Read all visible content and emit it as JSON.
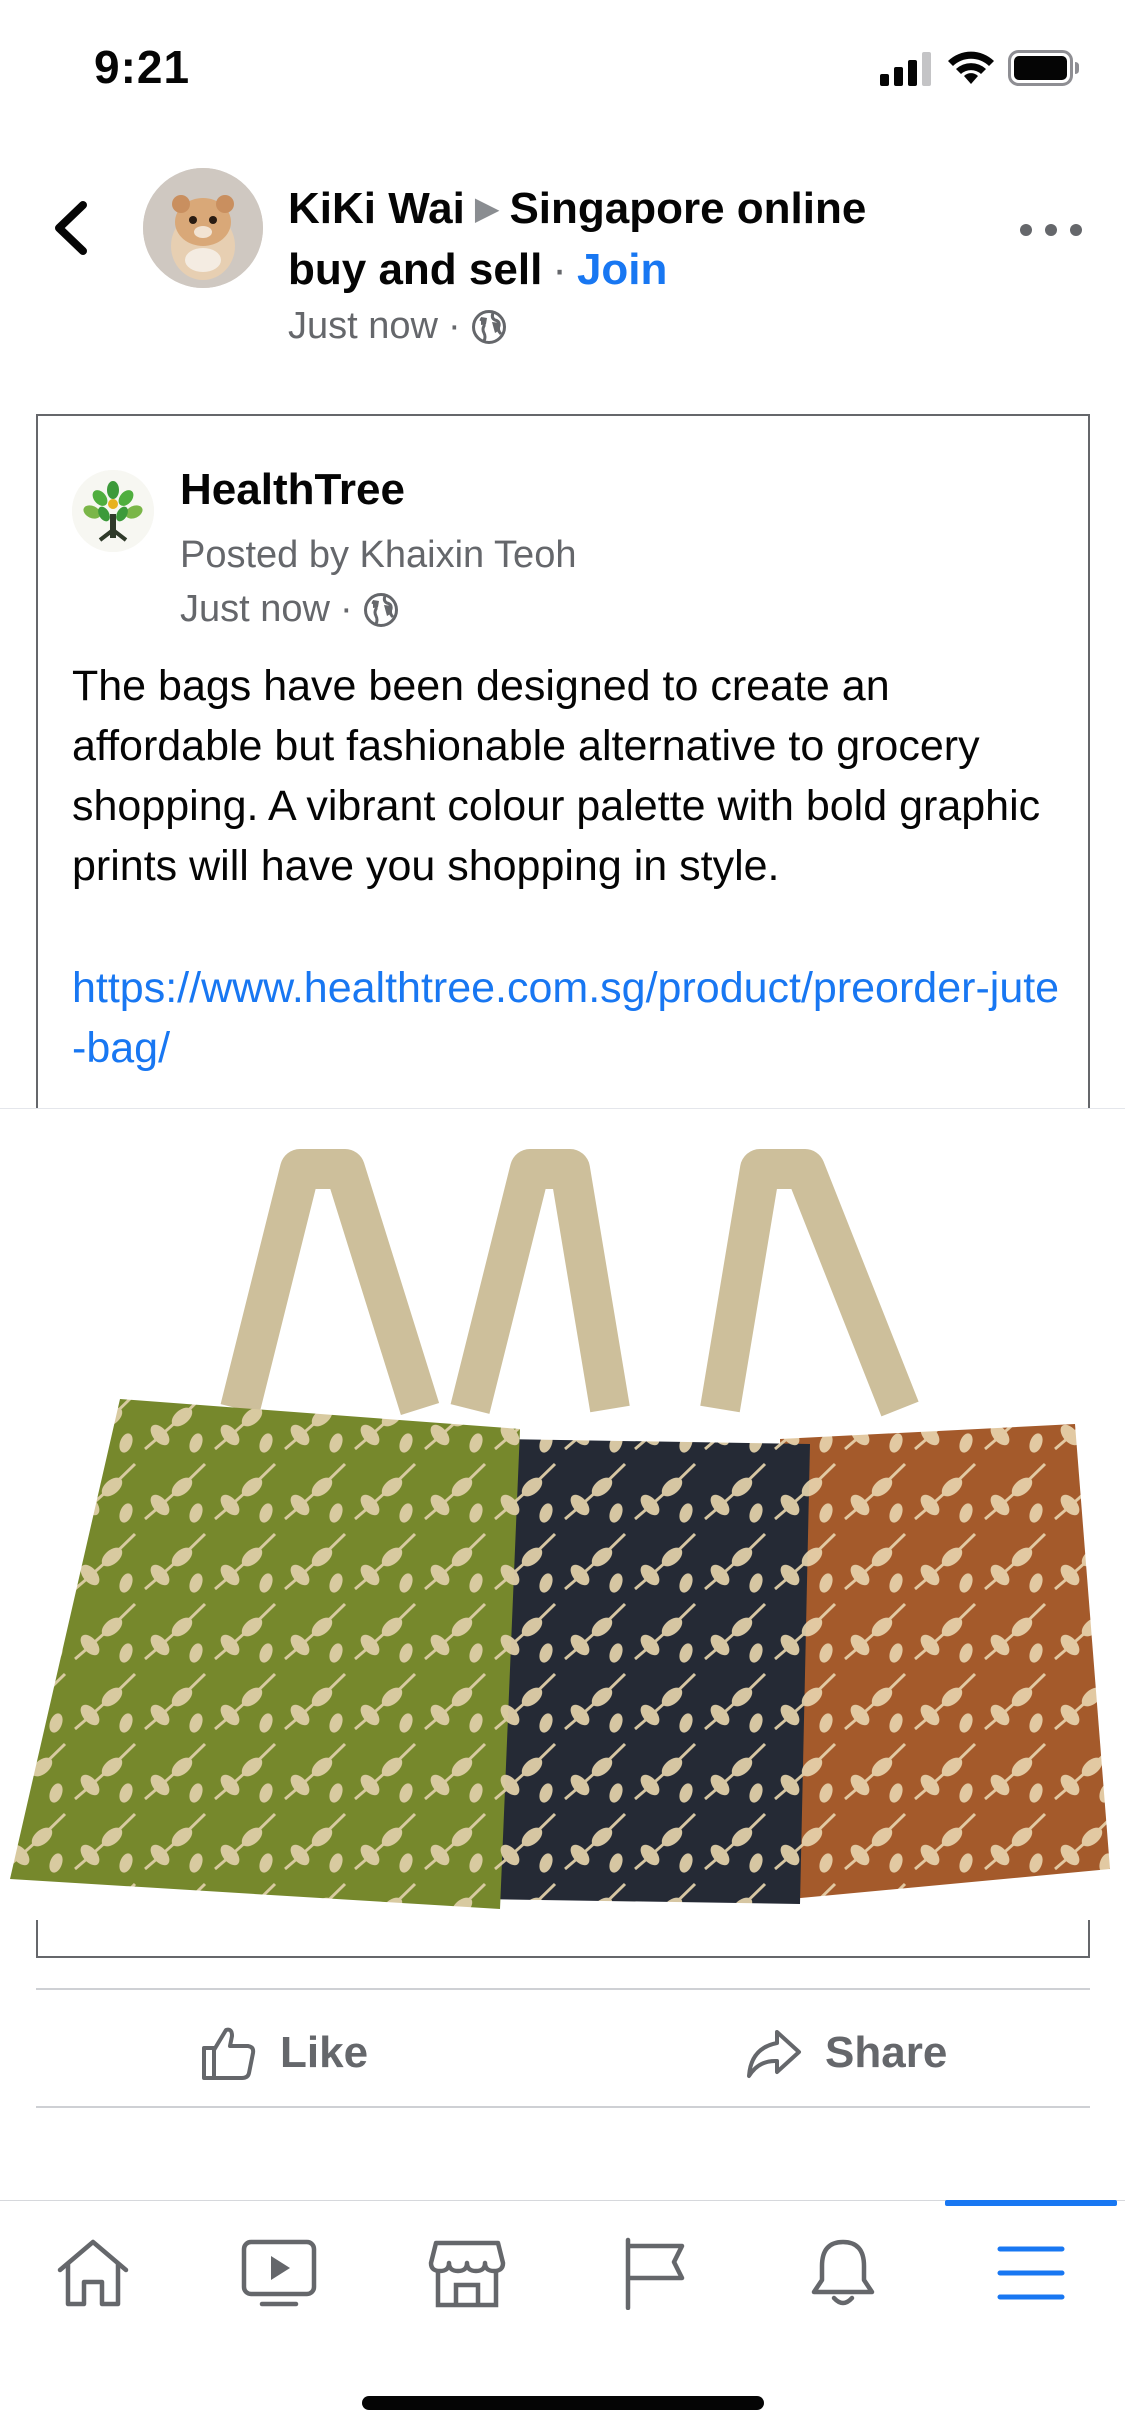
{
  "status_bar": {
    "time": "9:21",
    "signal_icon": "cellular-signal-icon",
    "wifi_icon": "wifi-icon",
    "battery_icon": "battery-icon"
  },
  "post_header": {
    "author": "KiKi Wai",
    "group_name": "Singapore online buy and sell",
    "separator": "·",
    "join_label": "Join",
    "time": "Just now",
    "meta_separator": "·",
    "privacy_icon": "globe-icon",
    "colors": {
      "link": "#1877f2",
      "meta": "#65676b"
    }
  },
  "shared_post": {
    "page_name": "HealthTree",
    "posted_by": "Posted by Khaixin Teoh",
    "time": "Just now",
    "meta_separator": "·",
    "body": "The bags have been designed to create an affordable but fashionable alternative to grocery shopping. A vibrant colour palette with bold graphic prints will have you shopping in style.",
    "link": "https://www.healthtree.com.sg/product/preorder-jute-bag/",
    "image_icon": "three-jute-tote-bags-photo"
  },
  "actions": {
    "like_label": "Like",
    "share_label": "Share"
  },
  "tab_bar": {
    "tabs": [
      "home-icon",
      "video-icon",
      "marketplace-icon",
      "pages-flag-icon",
      "notifications-bell-icon",
      "menu-icon"
    ],
    "active_tab": "menu-icon",
    "active_color": "#1877f2"
  }
}
